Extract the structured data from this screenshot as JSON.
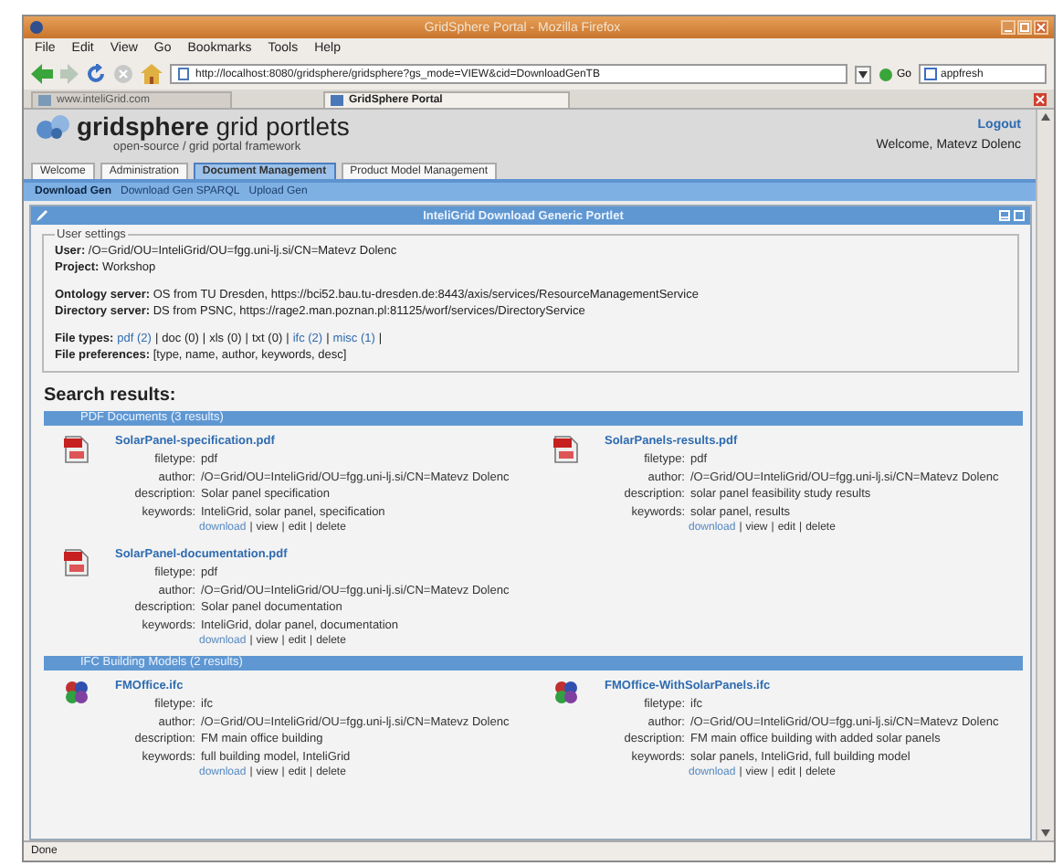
{
  "browser": {
    "title": "GridSphere Portal - Mozilla Firefox",
    "menu": [
      "File",
      "Edit",
      "View",
      "Go",
      "Bookmarks",
      "Tools",
      "Help"
    ],
    "url": "http://localhost:8080/gridsphere/gridsphere?gs_mode=VIEW&cid=DownloadGenTB",
    "go": "Go",
    "search": "appfresh",
    "tabs": [
      {
        "label": "www.inteliGrid.com",
        "selected": false
      },
      {
        "label": "GridSphere Portal",
        "selected": true
      }
    ],
    "status": "Done"
  },
  "portal": {
    "brand": "gridsphere",
    "product": "grid portlets",
    "tagline": "open-source / grid portal framework",
    "logout": "Logout",
    "welcome": "Welcome, Matevz Dolenc",
    "tabs": [
      {
        "label": "Welcome",
        "selected": false
      },
      {
        "label": "Administration",
        "selected": false
      },
      {
        "label": "Document Management",
        "selected": true
      },
      {
        "label": "Product Model Management",
        "selected": false
      }
    ],
    "subnav": [
      {
        "label": "Download Gen",
        "selected": true
      },
      {
        "label": "Download Gen SPARQL",
        "selected": false
      },
      {
        "label": "Upload Gen",
        "selected": false
      }
    ],
    "portlet": {
      "title": "InteliGrid Download Generic Portlet",
      "settings": {
        "legend": "User settings",
        "groups": [
          [
            {
              "label": "User:",
              "value": "/O=Grid/OU=InteliGrid/OU=fgg.uni-lj.si/CN=Matevz Dolenc"
            },
            {
              "label": "Project:",
              "value": "Workshop"
            }
          ],
          [
            {
              "label": "Ontology server:",
              "value": "OS from TU Dresden, https://bci52.bau.tu-dresden.de:8443/axis/services/ResourceManagementService"
            },
            {
              "label": "Directory server:",
              "value": "DS from PSNC, https://rage2.man.poznan.pl:81125/worf/services/DirectoryService"
            }
          ]
        ],
        "file_types": {
          "label": "File types:",
          "separator": "|",
          "items": [
            {
              "text": "pdf (2)",
              "link": true
            },
            {
              "text": "doc (0)",
              "link": false
            },
            {
              "text": "xls (0)",
              "link": false
            },
            {
              "text": "txt (0)",
              "link": false
            },
            {
              "text": "ifc (2)",
              "link": true
            },
            {
              "text": "misc (1)",
              "link": true
            }
          ]
        },
        "preferences": {
          "label": "File preferences:",
          "value": "[type, name, author, keywords, desc]"
        }
      },
      "results_heading": "Search results:",
      "groups": [
        {
          "title": "PDF Documents (3 results)",
          "results": [
            {
              "kind": "pdf",
              "name": "SolarPanel-specification.pdf",
              "fields": [
                {
                  "label": "filetype:",
                  "value": "pdf"
                },
                {
                  "label": "author:",
                  "value": "/O=Grid/OU=InteliGrid/OU=fgg.uni-lj.si/CN=Matevz Dolenc"
                },
                {
                  "label": "description:",
                  "value": "Solar panel specification"
                },
                {
                  "label": "keywords:",
                  "value": "InteliGrid, solar panel, specification"
                }
              ],
              "actions": {
                "separator": "|",
                "items": [
                  {
                    "text": "download",
                    "link": true
                  },
                  {
                    "text": "view",
                    "link": false
                  },
                  {
                    "text": "edit",
                    "link": false
                  },
                  {
                    "text": "delete",
                    "link": false
                  }
                ]
              }
            },
            {
              "kind": "pdf",
              "name": "SolarPanels-results.pdf",
              "fields": [
                {
                  "label": "filetype:",
                  "value": "pdf"
                },
                {
                  "label": "author:",
                  "value": "/O=Grid/OU=InteliGrid/OU=fgg.uni-lj.si/CN=Matevz Dolenc"
                },
                {
                  "label": "description:",
                  "value": "solar panel feasibility study results"
                },
                {
                  "label": "keywords:",
                  "value": "solar panel, results"
                }
              ],
              "actions": {
                "separator": "|",
                "items": [
                  {
                    "text": "download",
                    "link": true
                  },
                  {
                    "text": "view",
                    "link": false
                  },
                  {
                    "text": "edit",
                    "link": false
                  },
                  {
                    "text": "delete",
                    "link": false
                  }
                ]
              }
            },
            {
              "kind": "pdf",
              "name": "SolarPanel-documentation.pdf",
              "fields": [
                {
                  "label": "filetype:",
                  "value": "pdf"
                },
                {
                  "label": "author:",
                  "value": "/O=Grid/OU=InteliGrid/OU=fgg.uni-lj.si/CN=Matevz Dolenc"
                },
                {
                  "label": "description:",
                  "value": "Solar panel documentation"
                },
                {
                  "label": "keywords:",
                  "value": "InteliGrid, dolar panel, documentation"
                }
              ],
              "actions": {
                "separator": "|",
                "items": [
                  {
                    "text": "download",
                    "link": true
                  },
                  {
                    "text": "view",
                    "link": false
                  },
                  {
                    "text": "edit",
                    "link": false
                  },
                  {
                    "text": "delete",
                    "link": false
                  }
                ]
              }
            }
          ]
        },
        {
          "title": "IFC Building Models (2 results)",
          "results": [
            {
              "kind": "ifc",
              "name": "FMOffice.ifc",
              "fields": [
                {
                  "label": "filetype:",
                  "value": "ifc"
                },
                {
                  "label": "author:",
                  "value": "/O=Grid/OU=InteliGrid/OU=fgg.uni-lj.si/CN=Matevz Dolenc"
                },
                {
                  "label": "description:",
                  "value": "FM main office building"
                },
                {
                  "label": "keywords:",
                  "value": "full building model, InteliGrid"
                }
              ],
              "actions": {
                "separator": "|",
                "items": [
                  {
                    "text": "download",
                    "link": true
                  },
                  {
                    "text": "view",
                    "link": false
                  },
                  {
                    "text": "edit",
                    "link": false
                  },
                  {
                    "text": "delete",
                    "link": false
                  }
                ]
              }
            },
            {
              "kind": "ifc",
              "name": "FMOffice-WithSolarPanels.ifc",
              "fields": [
                {
                  "label": "filetype:",
                  "value": "ifc"
                },
                {
                  "label": "author:",
                  "value": "/O=Grid/OU=InteliGrid/OU=fgg.uni-lj.si/CN=Matevz Dolenc"
                },
                {
                  "label": "description:",
                  "value": "FM main office building with added solar panels"
                },
                {
                  "label": "keywords:",
                  "value": "solar panels, InteliGrid, full building model"
                }
              ],
              "actions": {
                "separator": "|",
                "items": [
                  {
                    "text": "download",
                    "link": true
                  },
                  {
                    "text": "view",
                    "link": false
                  },
                  {
                    "text": "edit",
                    "link": false
                  },
                  {
                    "text": "delete",
                    "link": false
                  }
                ]
              }
            }
          ]
        }
      ]
    }
  }
}
